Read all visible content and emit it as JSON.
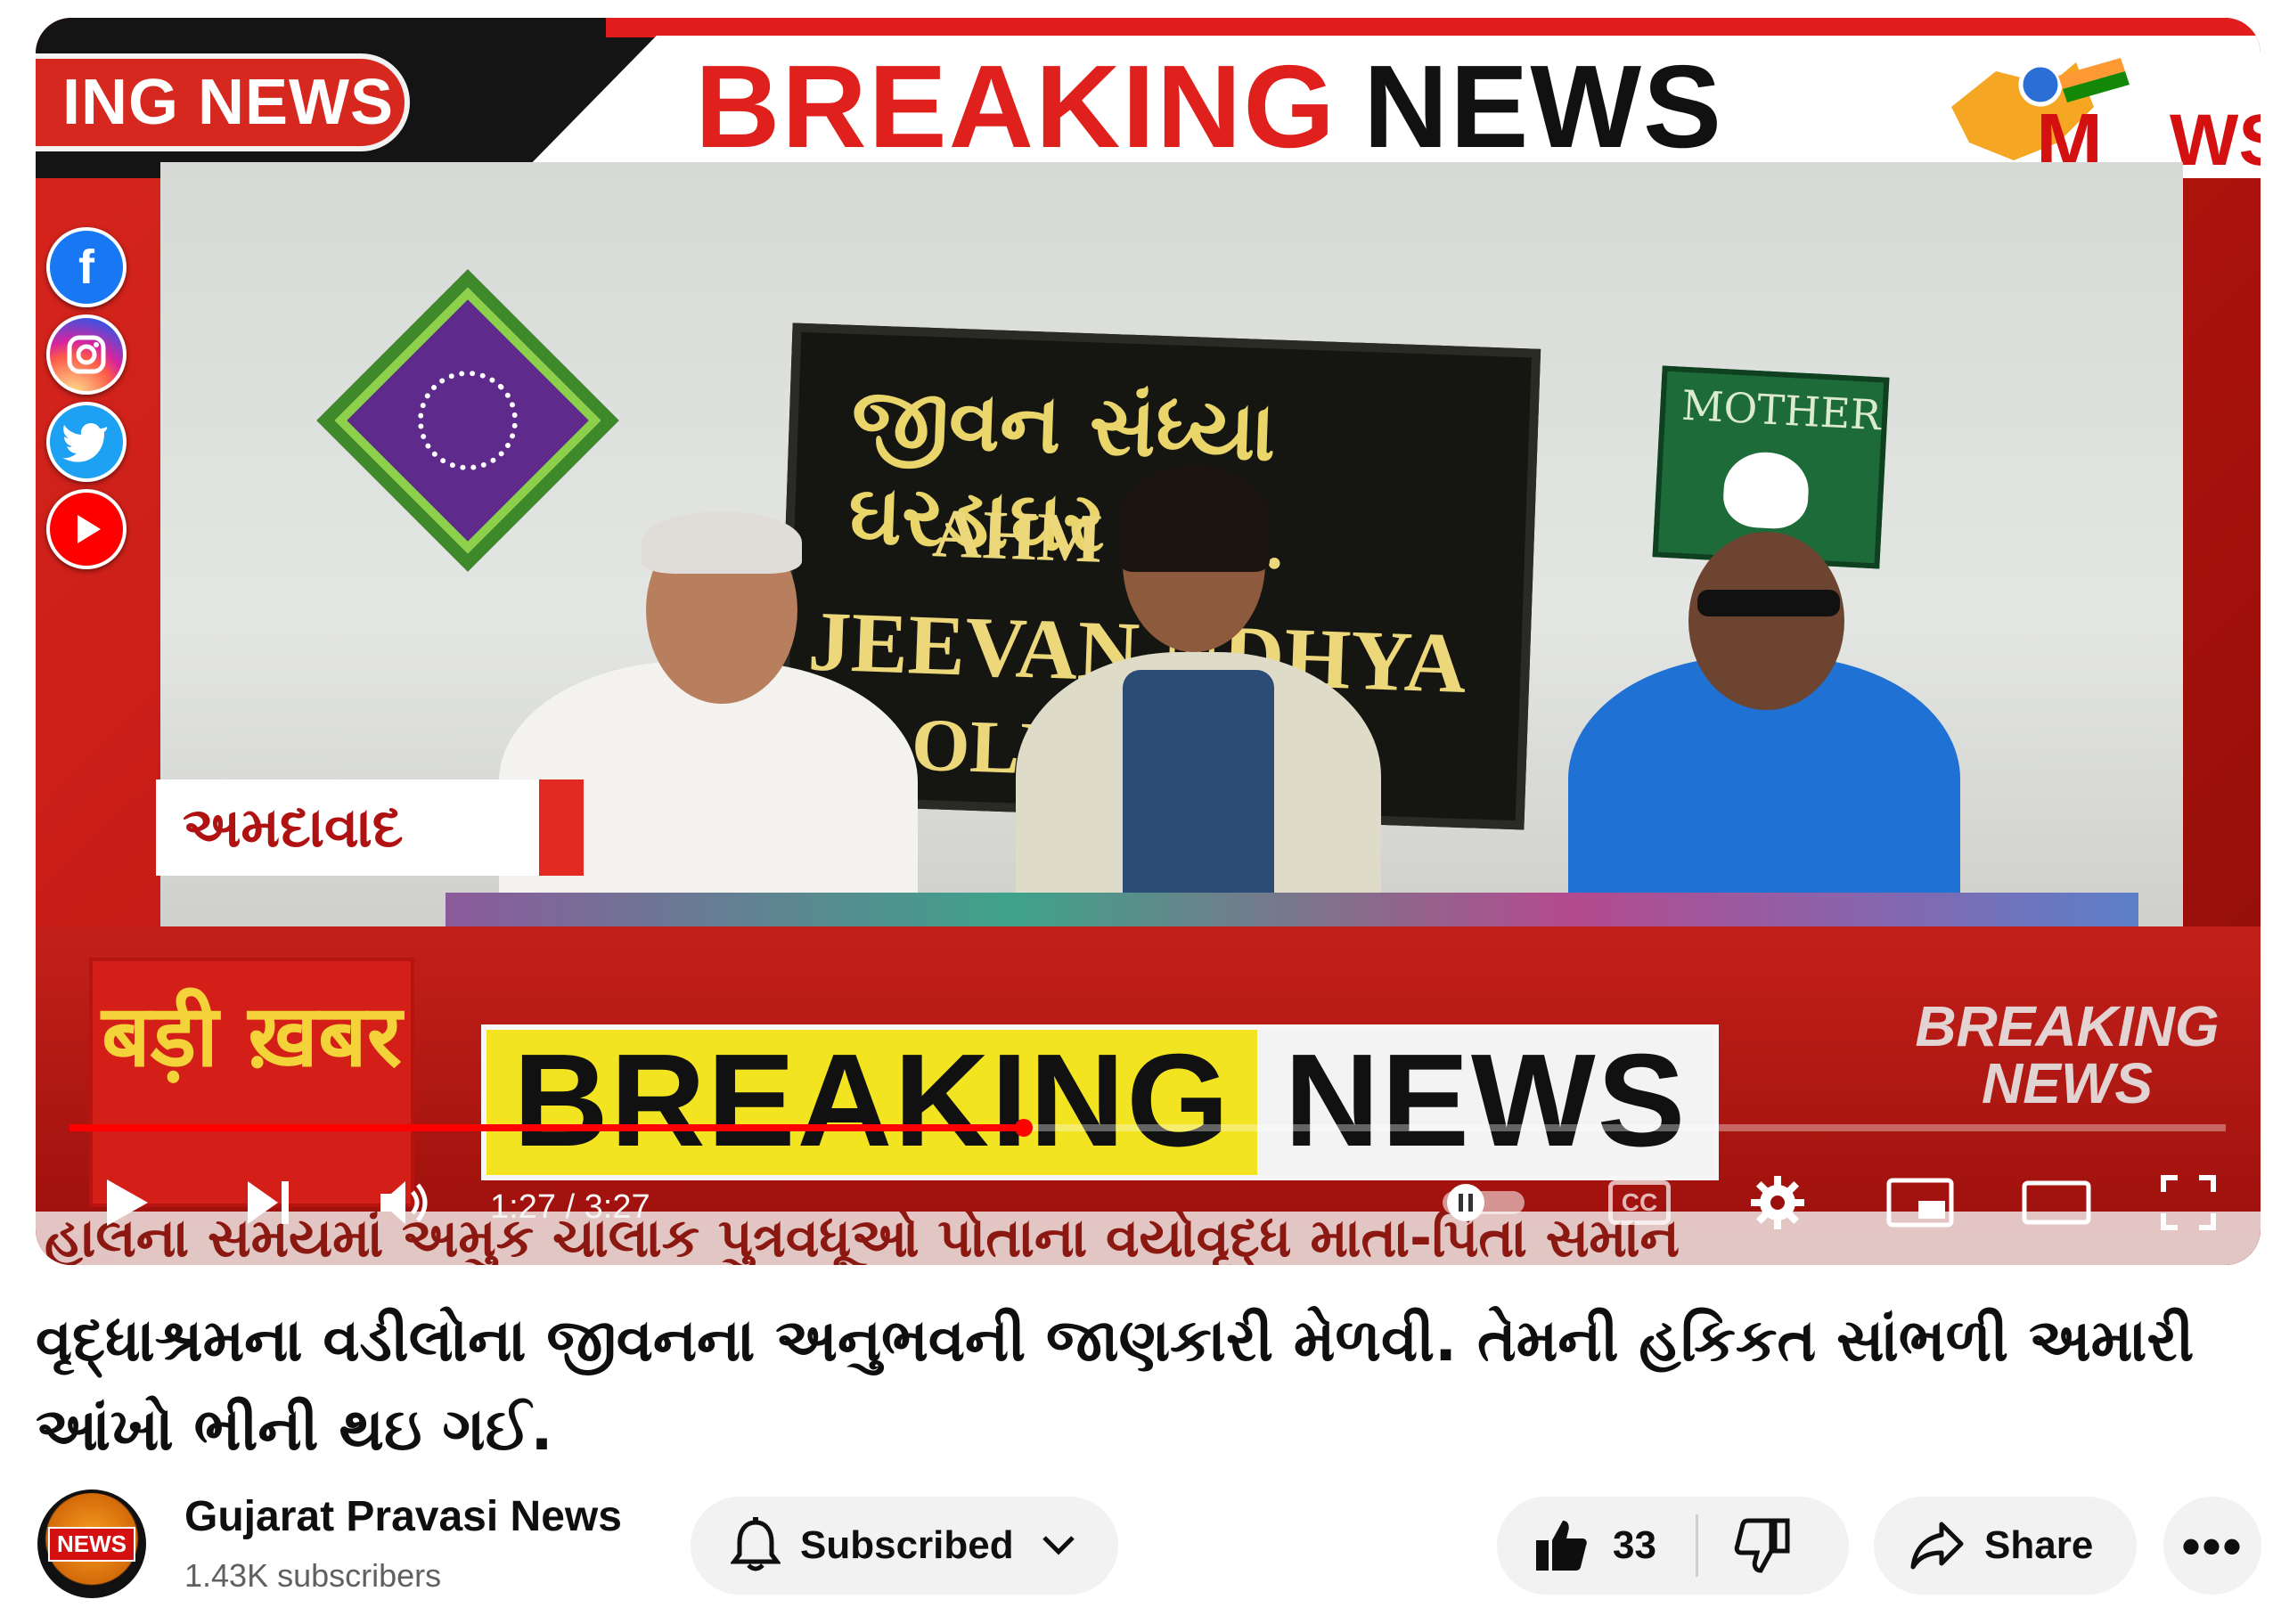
{
  "video": {
    "top_ticker": "ING NEWS",
    "top_breaking_1": "BREAKING",
    "top_breaking_2": "NEWS",
    "corner_logo_text": "WS",
    "socials": [
      "facebook-icon",
      "instagram-icon",
      "twitter-icon",
      "youtube-icon"
    ],
    "sign_gujarati": "જીવન સંધ્યા ઘરડાઘર",
    "sign_line1": "AHM BAD.",
    "sign_line2": "JEEVAN NDHYA",
    "sign_line3": "OLD OME",
    "mother_card": "MOTHER",
    "city_label": "અમદાવાદ",
    "badi_khabar": "बड़ी ख़बर",
    "breaking_bar_1": "BREAKING",
    "breaking_bar_2": "NEWS",
    "breaking_logo_1": "BREAKING",
    "breaking_logo_2": "NEWS",
    "crawl_text": "હાલના સમયમાં અમુક ચાલાક પુત્રવધૂઓ પોતાના વયોવૃદ્ધ માતા-પિતા સમાન",
    "progress_fraction": 0.4435,
    "time_display": "1:27 / 3:27"
  },
  "controls": {
    "play": "play-icon",
    "next": "next-icon",
    "volume": "volume-icon",
    "autoplay": "autoplay-toggle",
    "captions": "CC",
    "settings": "gear-icon",
    "miniplayer": "miniplayer-icon",
    "theater": "theater-icon",
    "fullscreen": "fullscreen-icon"
  },
  "title": "વૃદ્ધાશ્રમના વડીલોના જીવનના અનુભવની જાણકારી મેળવી. તેમની હકિકત સાંભળી અમારી આંખો ભીની થઇ ગઈ.",
  "channel": {
    "avatar_text": "NEWS",
    "name": "Gujarat Pravasi News",
    "subscribers": "1.43K subscribers",
    "subscribed_label": "Subscribed"
  },
  "actions": {
    "likes": "33",
    "share_label": "Share",
    "more_label": "•••"
  }
}
